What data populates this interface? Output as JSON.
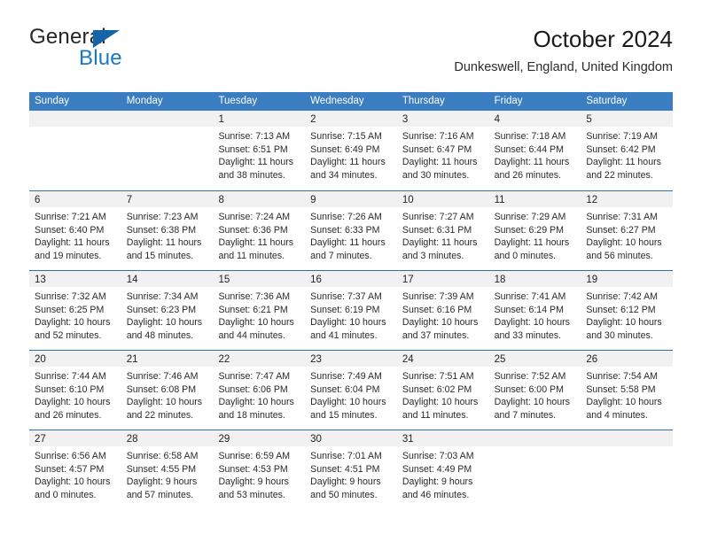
{
  "brand": {
    "name_part1": "General",
    "name_part2": "Blue",
    "accent_color": "#1a78c2",
    "triangle_color": "#1464aa"
  },
  "header": {
    "title": "October 2024",
    "subtitle": "Dunkeswell, England, United Kingdom"
  },
  "calendar": {
    "header_bg": "#3a7dc0",
    "header_text_color": "#ffffff",
    "daystrip_bg": "#f1f1f1",
    "weekdays": [
      "Sunday",
      "Monday",
      "Tuesday",
      "Wednesday",
      "Thursday",
      "Friday",
      "Saturday"
    ],
    "weeks": [
      [
        {
          "day": "",
          "empty": true
        },
        {
          "day": "",
          "empty": true
        },
        {
          "day": "1",
          "sunrise": "Sunrise: 7:13 AM",
          "sunset": "Sunset: 6:51 PM",
          "daylight1": "Daylight: 11 hours",
          "daylight2": "and 38 minutes."
        },
        {
          "day": "2",
          "sunrise": "Sunrise: 7:15 AM",
          "sunset": "Sunset: 6:49 PM",
          "daylight1": "Daylight: 11 hours",
          "daylight2": "and 34 minutes."
        },
        {
          "day": "3",
          "sunrise": "Sunrise: 7:16 AM",
          "sunset": "Sunset: 6:47 PM",
          "daylight1": "Daylight: 11 hours",
          "daylight2": "and 30 minutes."
        },
        {
          "day": "4",
          "sunrise": "Sunrise: 7:18 AM",
          "sunset": "Sunset: 6:44 PM",
          "daylight1": "Daylight: 11 hours",
          "daylight2": "and 26 minutes."
        },
        {
          "day": "5",
          "sunrise": "Sunrise: 7:19 AM",
          "sunset": "Sunset: 6:42 PM",
          "daylight1": "Daylight: 11 hours",
          "daylight2": "and 22 minutes."
        }
      ],
      [
        {
          "day": "6",
          "sunrise": "Sunrise: 7:21 AM",
          "sunset": "Sunset: 6:40 PM",
          "daylight1": "Daylight: 11 hours",
          "daylight2": "and 19 minutes."
        },
        {
          "day": "7",
          "sunrise": "Sunrise: 7:23 AM",
          "sunset": "Sunset: 6:38 PM",
          "daylight1": "Daylight: 11 hours",
          "daylight2": "and 15 minutes."
        },
        {
          "day": "8",
          "sunrise": "Sunrise: 7:24 AM",
          "sunset": "Sunset: 6:36 PM",
          "daylight1": "Daylight: 11 hours",
          "daylight2": "and 11 minutes."
        },
        {
          "day": "9",
          "sunrise": "Sunrise: 7:26 AM",
          "sunset": "Sunset: 6:33 PM",
          "daylight1": "Daylight: 11 hours",
          "daylight2": "and 7 minutes."
        },
        {
          "day": "10",
          "sunrise": "Sunrise: 7:27 AM",
          "sunset": "Sunset: 6:31 PM",
          "daylight1": "Daylight: 11 hours",
          "daylight2": "and 3 minutes."
        },
        {
          "day": "11",
          "sunrise": "Sunrise: 7:29 AM",
          "sunset": "Sunset: 6:29 PM",
          "daylight1": "Daylight: 11 hours",
          "daylight2": "and 0 minutes."
        },
        {
          "day": "12",
          "sunrise": "Sunrise: 7:31 AM",
          "sunset": "Sunset: 6:27 PM",
          "daylight1": "Daylight: 10 hours",
          "daylight2": "and 56 minutes."
        }
      ],
      [
        {
          "day": "13",
          "sunrise": "Sunrise: 7:32 AM",
          "sunset": "Sunset: 6:25 PM",
          "daylight1": "Daylight: 10 hours",
          "daylight2": "and 52 minutes."
        },
        {
          "day": "14",
          "sunrise": "Sunrise: 7:34 AM",
          "sunset": "Sunset: 6:23 PM",
          "daylight1": "Daylight: 10 hours",
          "daylight2": "and 48 minutes."
        },
        {
          "day": "15",
          "sunrise": "Sunrise: 7:36 AM",
          "sunset": "Sunset: 6:21 PM",
          "daylight1": "Daylight: 10 hours",
          "daylight2": "and 44 minutes."
        },
        {
          "day": "16",
          "sunrise": "Sunrise: 7:37 AM",
          "sunset": "Sunset: 6:19 PM",
          "daylight1": "Daylight: 10 hours",
          "daylight2": "and 41 minutes."
        },
        {
          "day": "17",
          "sunrise": "Sunrise: 7:39 AM",
          "sunset": "Sunset: 6:16 PM",
          "daylight1": "Daylight: 10 hours",
          "daylight2": "and 37 minutes."
        },
        {
          "day": "18",
          "sunrise": "Sunrise: 7:41 AM",
          "sunset": "Sunset: 6:14 PM",
          "daylight1": "Daylight: 10 hours",
          "daylight2": "and 33 minutes."
        },
        {
          "day": "19",
          "sunrise": "Sunrise: 7:42 AM",
          "sunset": "Sunset: 6:12 PM",
          "daylight1": "Daylight: 10 hours",
          "daylight2": "and 30 minutes."
        }
      ],
      [
        {
          "day": "20",
          "sunrise": "Sunrise: 7:44 AM",
          "sunset": "Sunset: 6:10 PM",
          "daylight1": "Daylight: 10 hours",
          "daylight2": "and 26 minutes."
        },
        {
          "day": "21",
          "sunrise": "Sunrise: 7:46 AM",
          "sunset": "Sunset: 6:08 PM",
          "daylight1": "Daylight: 10 hours",
          "daylight2": "and 22 minutes."
        },
        {
          "day": "22",
          "sunrise": "Sunrise: 7:47 AM",
          "sunset": "Sunset: 6:06 PM",
          "daylight1": "Daylight: 10 hours",
          "daylight2": "and 18 minutes."
        },
        {
          "day": "23",
          "sunrise": "Sunrise: 7:49 AM",
          "sunset": "Sunset: 6:04 PM",
          "daylight1": "Daylight: 10 hours",
          "daylight2": "and 15 minutes."
        },
        {
          "day": "24",
          "sunrise": "Sunrise: 7:51 AM",
          "sunset": "Sunset: 6:02 PM",
          "daylight1": "Daylight: 10 hours",
          "daylight2": "and 11 minutes."
        },
        {
          "day": "25",
          "sunrise": "Sunrise: 7:52 AM",
          "sunset": "Sunset: 6:00 PM",
          "daylight1": "Daylight: 10 hours",
          "daylight2": "and 7 minutes."
        },
        {
          "day": "26",
          "sunrise": "Sunrise: 7:54 AM",
          "sunset": "Sunset: 5:58 PM",
          "daylight1": "Daylight: 10 hours",
          "daylight2": "and 4 minutes."
        }
      ],
      [
        {
          "day": "27",
          "sunrise": "Sunrise: 6:56 AM",
          "sunset": "Sunset: 4:57 PM",
          "daylight1": "Daylight: 10 hours",
          "daylight2": "and 0 minutes."
        },
        {
          "day": "28",
          "sunrise": "Sunrise: 6:58 AM",
          "sunset": "Sunset: 4:55 PM",
          "daylight1": "Daylight: 9 hours",
          "daylight2": "and 57 minutes."
        },
        {
          "day": "29",
          "sunrise": "Sunrise: 6:59 AM",
          "sunset": "Sunset: 4:53 PM",
          "daylight1": "Daylight: 9 hours",
          "daylight2": "and 53 minutes."
        },
        {
          "day": "30",
          "sunrise": "Sunrise: 7:01 AM",
          "sunset": "Sunset: 4:51 PM",
          "daylight1": "Daylight: 9 hours",
          "daylight2": "and 50 minutes."
        },
        {
          "day": "31",
          "sunrise": "Sunrise: 7:03 AM",
          "sunset": "Sunset: 4:49 PM",
          "daylight1": "Daylight: 9 hours",
          "daylight2": "and 46 minutes."
        },
        {
          "day": "",
          "empty": true
        },
        {
          "day": "",
          "empty": true
        }
      ]
    ]
  }
}
